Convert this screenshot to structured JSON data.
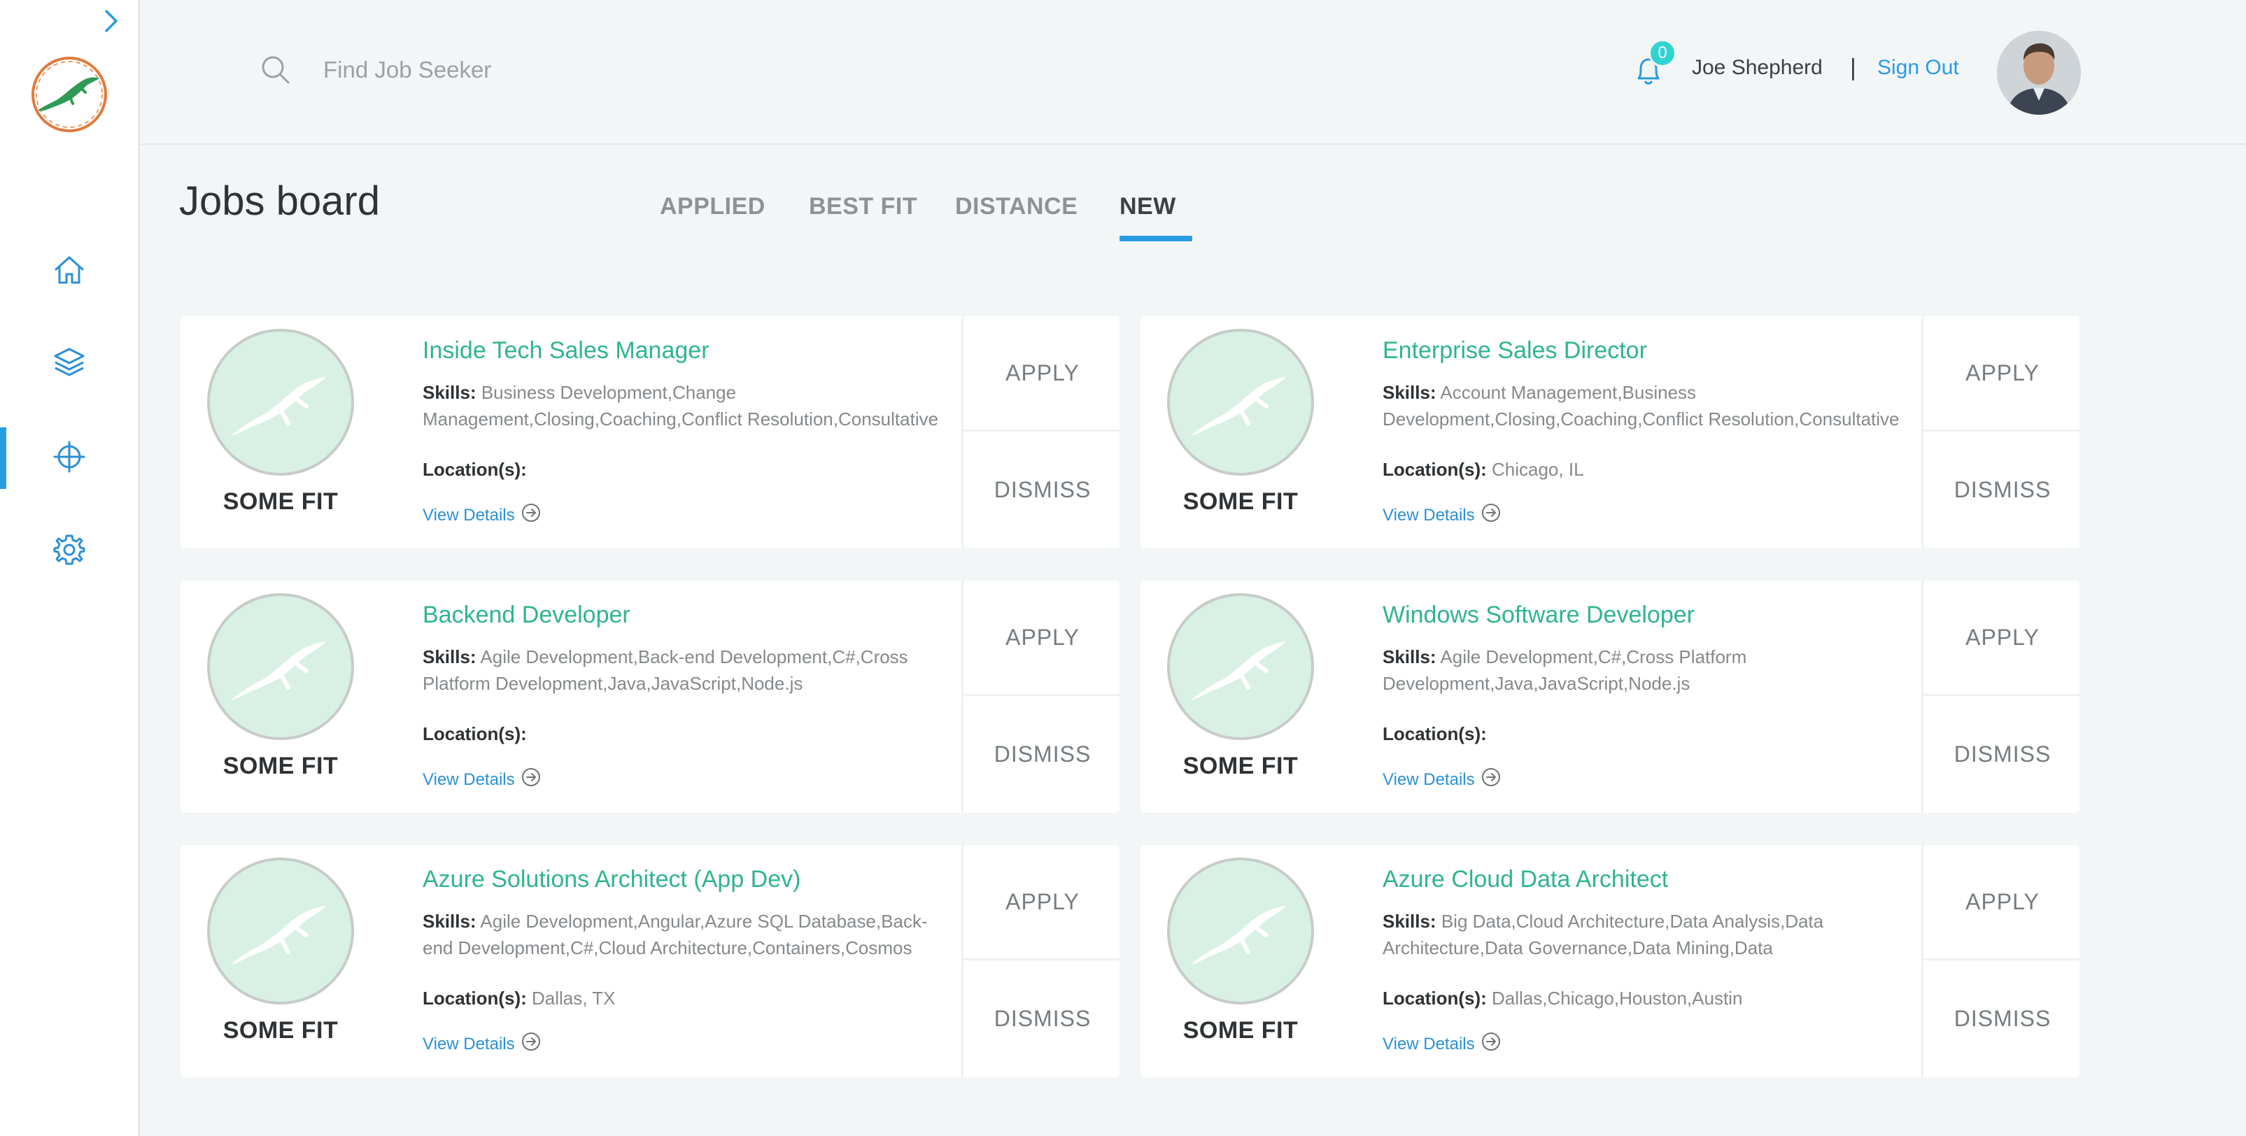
{
  "sidebar": {
    "expand_icon": "chevron-right-icon",
    "items": [
      {
        "name": "home",
        "icon": "home-icon",
        "active": false
      },
      {
        "name": "layers",
        "icon": "layers-icon",
        "active": false
      },
      {
        "name": "crosshair",
        "icon": "crosshair-icon",
        "active": true
      },
      {
        "name": "settings",
        "icon": "gear-icon",
        "active": false
      }
    ]
  },
  "header": {
    "search_placeholder": "Find Job Seeker",
    "notification_count": "0",
    "user_name": "Joe Shepherd",
    "separator": "|",
    "sign_out": "Sign Out"
  },
  "page": {
    "title": "Jobs board",
    "tabs": [
      {
        "label": "APPLIED",
        "active": false
      },
      {
        "label": "BEST FIT",
        "active": false
      },
      {
        "label": "DISTANCE",
        "active": false
      },
      {
        "label": "NEW",
        "active": true
      }
    ]
  },
  "labels": {
    "skills": "Skills:",
    "locations": "Location(s):",
    "view_details": "View Details",
    "apply": "APPLY",
    "dismiss": "DISMISS"
  },
  "jobs": [
    {
      "fit": "SOME FIT",
      "title": "Inside Tech Sales Manager",
      "skills": "Business Development,Change Management,Closing,Coaching,Conflict Resolution,Consultative Selling,Customer",
      "locations": ""
    },
    {
      "fit": "SOME FIT",
      "title": "Enterprise Sales Director",
      "skills": "Account Management,Business Development,Closing,Coaching,Conflict Resolution,Consultative Selling,CRM,Cross Sell,Customer",
      "locations": "Chicago, IL"
    },
    {
      "fit": "SOME FIT",
      "title": "Backend Developer",
      "skills": "Agile Development,Back-end Development,C#,Cross Platform Development,Java,JavaScript,Node.js",
      "locations": ""
    },
    {
      "fit": "SOME FIT",
      "title": "Windows Software Developer",
      "skills": "Agile Development,C#,Cross Platform Development,Java,JavaScript,Node.js",
      "locations": ""
    },
    {
      "fit": "SOME FIT",
      "title": "Azure Solutions Architect (App Dev)",
      "skills": "Agile Development,Angular,Azure SQL Database,Back-end Development,C#,Cloud Architecture,Containers,Cosmos DB,Design",
      "locations": "Dallas, TX"
    },
    {
      "fit": "SOME FIT",
      "title": "Azure Cloud Data Architect",
      "skills": "Big Data,Cloud Architecture,Data Analysis,Data Architecture,Data Governance,Data Mining,Data Warehousing,Predictive Analytics,SQL,Visualization",
      "locations": "Dallas,Chicago,Houston,Austin"
    }
  ],
  "colors": {
    "accent": "#2a9be0",
    "job_title": "#2fb58e",
    "fit_circle": "#d9f1e5",
    "badge": "#30d3d0"
  }
}
